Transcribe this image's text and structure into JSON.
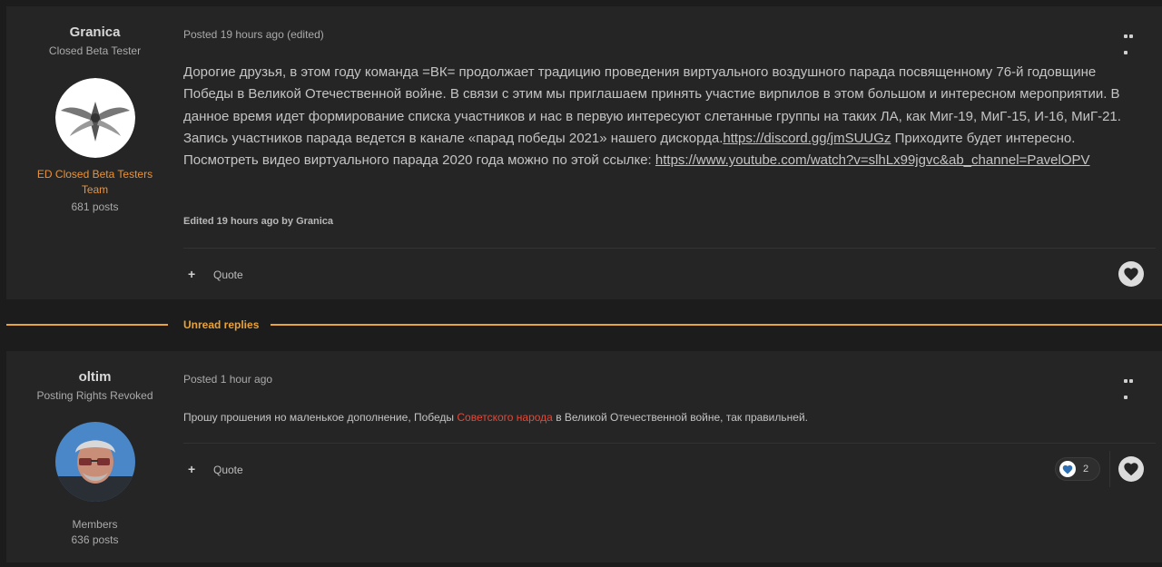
{
  "posts": [
    {
      "author": {
        "name": "Granica",
        "title": "Closed Beta Tester",
        "group_line1": "ED Closed Beta Testers",
        "group_line2": "Team",
        "post_count": "681 posts"
      },
      "meta": "Posted 19 hours ago (edited)",
      "content": {
        "text_before_link1": "Дорогие друзья, в этом году команда =ВК= продолжает традицию проведения виртуального воздушного парада посвященному 76-й годовщине Победы в Великой Отечественной войне. В связи с этим мы приглашаем принять участие вирпилов в этом большом и интересном мероприятии. В данное время идет формирование списка участников и нас в первую интересуют слетанные группы на таких ЛА, как Миг-19, МиГ-15, И-16, МиГ-21. Запись участников парада ведется в канале «парад победы 2021» нашего дискорда.",
        "link1": "https://discord.gg/jmSUUGz",
        "text_between": "  Приходите будет интересно. Посмотреть видео виртуального парада 2020 года можно по этой ссылке: ",
        "link2": "https://www.youtube.com/watch?v=slhLx99jgvc&ab_channel=PavelOPV"
      },
      "edited_note": "Edited 19 hours ago by Granica",
      "actions": {
        "plus": "+",
        "quote": "Quote"
      }
    },
    {
      "author": {
        "name": "oltim",
        "title": "Posting Rights Revoked",
        "group": "Members",
        "post_count": "636 posts"
      },
      "meta": "Posted 1 hour ago",
      "content": {
        "text_before": "Прошу прошения но маленькое дополнение, Победы ",
        "highlight": "Советского народа",
        "text_after": " в Великой Отечественной войне, так  правильней."
      },
      "actions": {
        "plus": "+",
        "quote": "Quote",
        "reaction_count": "2"
      }
    }
  ],
  "divider_label": "Unread replies",
  "colors": {
    "background": "#1c1c1c",
    "post_bg": "#252525",
    "accent_orange": "#e8a33a",
    "group_orange": "#e8933a",
    "highlight_red": "#e04a3a",
    "reaction_blue": "#2f6fb3"
  },
  "icons": {
    "menu": "ellipsis-icon",
    "like": "heart-icon",
    "reaction": "heart-reaction-icon",
    "plus": "plus-icon"
  }
}
